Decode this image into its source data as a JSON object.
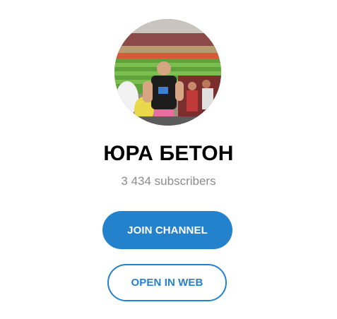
{
  "channel": {
    "title": "ЮРА БЕТОН",
    "subscribers": "3 434 subscribers"
  },
  "buttons": {
    "join_label": "JOIN CHANNEL",
    "open_web_label": "OPEN IN WEB"
  },
  "colors": {
    "accent": "#2481cc",
    "title": "#000000",
    "muted": "#8c8c8c",
    "background": "#ffffff"
  }
}
